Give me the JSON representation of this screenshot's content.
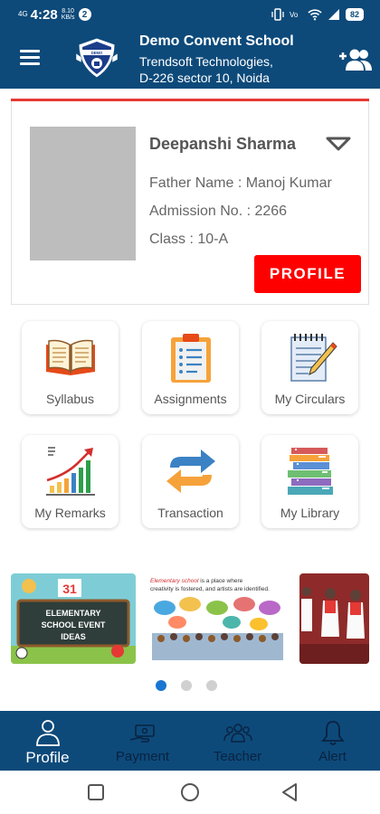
{
  "status_bar": {
    "network": "4G",
    "time": "4:28",
    "speed_value": "8.10",
    "speed_unit": "KB/s",
    "battery": "82"
  },
  "header": {
    "school_name": "Demo Convent School",
    "line1": "Trendsoft Technologies,",
    "line2": "D-226 sector 10, Noida"
  },
  "student": {
    "name": "Deepanshi Sharma",
    "father": "Father Name : Manoj Kumar",
    "admission": "Admission No. : 2266",
    "class": "Class : 10-A",
    "profile_button": "PROFILE"
  },
  "tiles": [
    {
      "label": "Syllabus",
      "icon": "open-book-icon"
    },
    {
      "label": "Assignments",
      "icon": "clipboard-list-icon"
    },
    {
      "label": "My Circulars",
      "icon": "notepad-pencil-icon"
    },
    {
      "label": "My Remarks",
      "icon": "growth-chart-icon"
    },
    {
      "label": "Transaction",
      "icon": "exchange-arrows-icon"
    },
    {
      "label": "My Library",
      "icon": "book-stack-icon"
    }
  ],
  "banners": {
    "banner1_line1": "ELEMENTARY",
    "banner1_line2": "SCHOOL EVENT",
    "banner1_line3": "IDEAS",
    "banner1_number": "31",
    "banner2_text_highlight": "Elementary school",
    "banner2_text_rest": " is a place where",
    "banner2_line2": "creativity is fostered, and artists are identified."
  },
  "carousel": {
    "count": 3,
    "active": 0
  },
  "bottom_nav": [
    {
      "label": "Profile",
      "icon": "person-icon",
      "active": true
    },
    {
      "label": "Payment",
      "icon": "payment-hand-icon",
      "active": false
    },
    {
      "label": "Teacher",
      "icon": "group-icon",
      "active": false
    },
    {
      "label": "Alert",
      "icon": "bell-icon",
      "active": false
    }
  ],
  "colors": {
    "primary": "#0d4a7a",
    "accent_red": "#ff0000",
    "dot_active": "#1976d2"
  }
}
